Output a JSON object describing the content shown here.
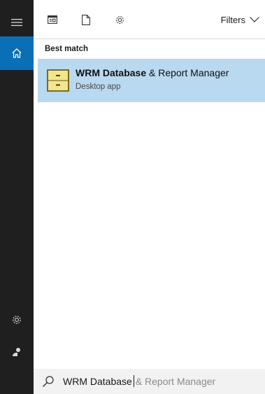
{
  "rail": {
    "icons": [
      "hamburger-icon",
      "home-icon",
      "gear-icon",
      "user-icon"
    ],
    "active_color": "#0b6fb5",
    "background": "#1f1f1f"
  },
  "toolbar": {
    "icons": [
      "apps-icon",
      "document-icon",
      "gear-icon"
    ],
    "filters_label": "Filters"
  },
  "results": {
    "section_label": "Best match",
    "best_match": {
      "title_bold": "WRM Database",
      "title_rest": " & Report Manager",
      "subtitle": "Desktop app",
      "highlight_color": "#b8d9f0"
    }
  },
  "search": {
    "typed": "WRM Database",
    "suggestion": "& Report Manager"
  }
}
